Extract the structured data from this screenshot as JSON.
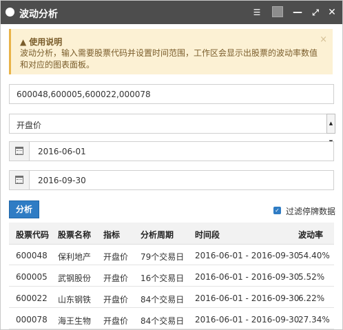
{
  "window": {
    "title": "波动分析",
    "controls": {
      "settings_icon": "sliders-icon",
      "square_icon": "square-icon",
      "minimize_icon": "minimize-icon",
      "maximize_icon": "expand-icon",
      "close_icon": "close-icon"
    },
    "title_bar_color": "#4d4d4d"
  },
  "alert": {
    "heading": "使用说明",
    "body": "波动分析，输入需要股票代码并设置时间范围，工作区会显示出股票的波动率数值和对应的图表面板。",
    "close_glyph": "×",
    "background_color": "#fcf1d4"
  },
  "form": {
    "codes_value": "600048,600005,600022,000078",
    "indicator_selected": "开盘价",
    "start_date": "2016-06-01",
    "end_date": "2016-09-30",
    "analyze_label": "分析",
    "filter_label": "过滤停牌数据",
    "filter_checked": true,
    "accent_color": "#2f7cc4"
  },
  "table": {
    "headers": [
      "股票代码",
      "股票名称",
      "指标",
      "分析周期",
      "时间段",
      "波动率"
    ],
    "rows": [
      [
        "600048",
        "保利地产",
        "开盘价",
        "79个交易日",
        "2016-06-01 - 2016-09-30",
        "54.40%"
      ],
      [
        "600005",
        "武钢股份",
        "开盘价",
        "16个交易日",
        "2016-06-01 - 2016-09-30",
        "5.52%"
      ],
      [
        "600022",
        "山东钢铁",
        "开盘价",
        "84个交易日",
        "2016-06-01 - 2016-09-30",
        "6.22%"
      ],
      [
        "000078",
        "海王生物",
        "开盘价",
        "84个交易日",
        "2016-06-01 - 2016-09-30",
        "27.34%"
      ]
    ]
  }
}
